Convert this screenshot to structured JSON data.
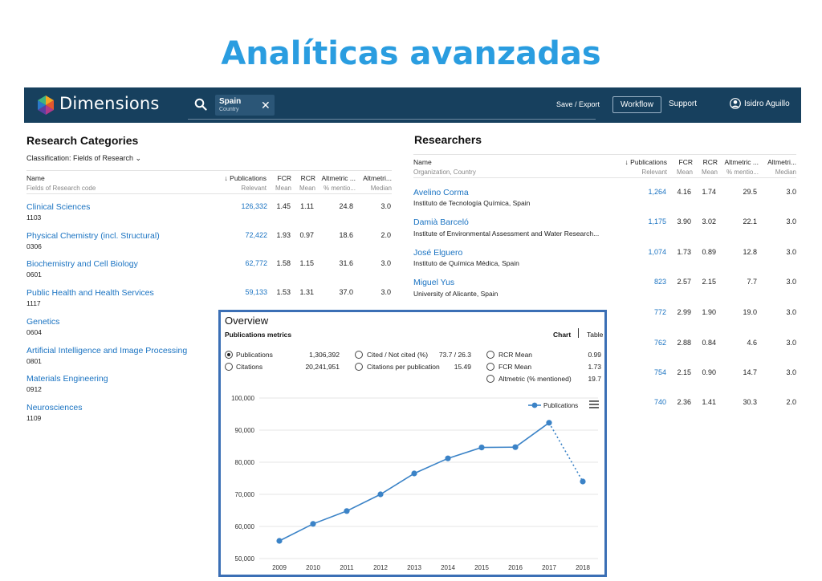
{
  "slide_title": "Analíticas avanzadas",
  "colors": {
    "header_bg": "#17405e",
    "link": "#1a73c2",
    "title": "#2a9de0",
    "series": "#3b83c7",
    "border": "#3b6fb5"
  },
  "header": {
    "logo_text": "Dimensions",
    "logo_icon": "dimensions-logo-icon",
    "search_icon": "search-icon",
    "chip": {
      "label": "Spain",
      "sub": "Country",
      "close": "✕"
    },
    "save_export": "Save / Export",
    "workflow": "Workflow",
    "support": "Support",
    "user_icon": "user-icon",
    "user": "Isidro Aguillo"
  },
  "research_categories": {
    "title": "Research Categories",
    "classification": "Classification: Fields of Research ⌄",
    "columns": {
      "name": "Name",
      "name_sub": "Fields of Research code",
      "pubs": "↓ Publications",
      "pubs_sub": "Relevant",
      "fcr": "FCR",
      "fcr_sub": "Mean",
      "rcr": "RCR",
      "rcr_sub": "Mean",
      "alt": "Altmetric ...",
      "alt_sub": "% mentio...",
      "alt2": "Altmetri...",
      "alt2_sub": "Median"
    },
    "rows": [
      {
        "name": "Clinical Sciences",
        "code": "1103",
        "pubs": "126,332",
        "fcr": "1.45",
        "rcr": "1.11",
        "alt": "24.8",
        "alt2": "3.0"
      },
      {
        "name": "Physical Chemistry (incl. Structural)",
        "code": "0306",
        "pubs": "72,422",
        "fcr": "1.93",
        "rcr": "0.97",
        "alt": "18.6",
        "alt2": "2.0"
      },
      {
        "name": "Biochemistry and Cell Biology",
        "code": "0601",
        "pubs": "62,772",
        "fcr": "1.58",
        "rcr": "1.15",
        "alt": "31.6",
        "alt2": "3.0"
      },
      {
        "name": "Public Health and Health Services",
        "code": "1117",
        "pubs": "59,133",
        "fcr": "1.53",
        "rcr": "1.31",
        "alt": "37.0",
        "alt2": "3.0"
      },
      {
        "name": "Genetics",
        "code": "0604"
      },
      {
        "name": "Artificial Intelligence and Image Processing",
        "code": "0801"
      },
      {
        "name": "Materials Engineering",
        "code": "0912"
      },
      {
        "name": "Neurosciences",
        "code": "1109"
      }
    ]
  },
  "researchers": {
    "title": "Researchers",
    "columns": {
      "name": "Name",
      "name_sub": "Organization, Country",
      "pubs": "↓ Publications",
      "pubs_sub": "Relevant",
      "fcr": "FCR",
      "fcr_sub": "Mean",
      "rcr": "RCR",
      "rcr_sub": "Mean",
      "alt": "Altmetric ...",
      "alt_sub": "% mentio...",
      "alt2": "Altmetri...",
      "alt2_sub": "Median"
    },
    "rows": [
      {
        "name": "Avelino Corma",
        "org": "Instituto de Tecnología Química, Spain",
        "pubs": "1,264",
        "fcr": "4.16",
        "rcr": "1.74",
        "alt": "29.5",
        "alt2": "3.0"
      },
      {
        "name": "Damià Barceló",
        "org": "Institute of Environmental Assessment and Water Research...",
        "pubs": "1,175",
        "fcr": "3.90",
        "rcr": "3.02",
        "alt": "22.1",
        "alt2": "3.0"
      },
      {
        "name": "José Elguero",
        "org": "Instituto de Química Médica, Spain",
        "pubs": "1,074",
        "fcr": "1.73",
        "rcr": "0.89",
        "alt": "12.8",
        "alt2": "3.0"
      },
      {
        "name": "Miguel Yus",
        "org": "University of Alicante, Spain",
        "pubs": "823",
        "fcr": "2.57",
        "rcr": "2.15",
        "alt": "7.7",
        "alt2": "3.0"
      },
      {
        "pubs": "772",
        "fcr": "2.99",
        "rcr": "1.90",
        "alt": "19.0",
        "alt2": "3.0"
      },
      {
        "pubs": "762",
        "fcr": "2.88",
        "rcr": "0.84",
        "alt": "4.6",
        "alt2": "3.0"
      },
      {
        "pubs": "754",
        "fcr": "2.15",
        "rcr": "0.90",
        "alt": "14.7",
        "alt2": "3.0"
      },
      {
        "pubs": "740",
        "fcr": "2.36",
        "rcr": "1.41",
        "alt": "30.3",
        "alt2": "2.0"
      }
    ]
  },
  "overview": {
    "title": "Overview",
    "subtitle": "Publications metrics",
    "tabs": {
      "chart": "Chart",
      "table": "Table"
    },
    "metrics": [
      {
        "label": "Publications",
        "value": "1,306,392",
        "selected": true
      },
      {
        "label": "Citations",
        "value": "20,241,951",
        "selected": false
      },
      {
        "label": "Cited / Not cited (%)",
        "value": "73.7 / 26.3",
        "selected": false
      },
      {
        "label": "Citations per publication",
        "value": "15.49",
        "selected": false
      },
      {
        "label": "RCR Mean",
        "value": "0.99",
        "selected": false
      },
      {
        "label": "FCR Mean",
        "value": "1.73",
        "selected": false
      },
      {
        "label": "Altmetric (% mentioned)",
        "value": "19.7",
        "selected": false
      }
    ],
    "menu_icon": "hamburger-menu-icon"
  },
  "chart_data": {
    "type": "line",
    "x": [
      "2009",
      "2010",
      "2011",
      "2012",
      "2013",
      "2014",
      "2015",
      "2016",
      "2017",
      "2018"
    ],
    "series": [
      {
        "name": "Publications",
        "values": [
          55500,
          60800,
          64800,
          70000,
          76500,
          81200,
          84600,
          84700,
          92300,
          74000
        ]
      }
    ],
    "dashed_last_segment": true,
    "ylim": [
      50000,
      100000
    ],
    "yticks": [
      50000,
      60000,
      70000,
      80000,
      90000,
      100000
    ],
    "ytick_labels": [
      "50,000",
      "60,000",
      "70,000",
      "80,000",
      "90,000",
      "100,000"
    ],
    "legend_position": "top-right",
    "grid": true
  }
}
